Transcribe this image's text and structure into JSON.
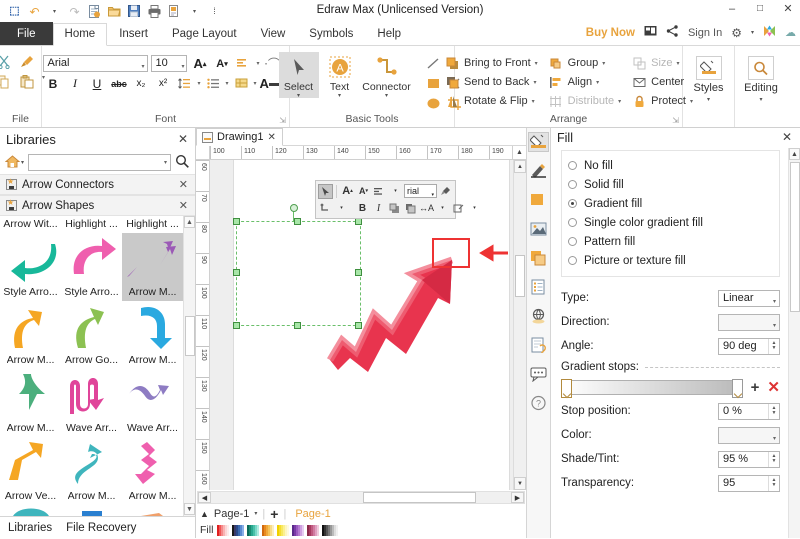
{
  "app": {
    "title": "Edraw Max (Unlicensed Version)",
    "accent_orange": "#e8a33d",
    "selection_green": "#6abf6a",
    "annotation_red": "#ee3333"
  },
  "quick_access": {
    "items": [
      {
        "name": "edraw-logo-icon",
        "glyph": "E"
      },
      {
        "name": "undo-icon",
        "glyph": "↶"
      },
      {
        "name": "undo-dropdown-caret-icon",
        "glyph": "▾"
      },
      {
        "name": "redo-icon",
        "glyph": "↷"
      },
      {
        "name": "new-document-icon",
        "glyph": "὜B"
      },
      {
        "name": "open-folder-icon",
        "glyph": "Ὄ2"
      },
      {
        "name": "save-icon",
        "glyph": "ὋE"
      },
      {
        "name": "print-icon",
        "glyph": "⎙"
      },
      {
        "name": "export-icon",
        "glyph": "὜E"
      },
      {
        "name": "quick-access-caret-icon",
        "glyph": "▾"
      },
      {
        "name": "customize-quick-access-icon",
        "glyph": "⋮"
      }
    ]
  },
  "window_controls": [
    {
      "name": "minimize-button",
      "glyph": "–"
    },
    {
      "name": "maximize-button",
      "glyph": "☐"
    },
    {
      "name": "close-button",
      "glyph": "✕"
    }
  ],
  "ribbon_tabs": [
    {
      "label": "File",
      "active": false,
      "kind": "file"
    },
    {
      "label": "Home",
      "active": true,
      "kind": "tab"
    },
    {
      "label": "Insert",
      "active": false,
      "kind": "tab"
    },
    {
      "label": "Page Layout",
      "active": false,
      "kind": "tab"
    },
    {
      "label": "View",
      "active": false,
      "kind": "tab"
    },
    {
      "label": "Symbols",
      "active": false,
      "kind": "tab"
    },
    {
      "label": "Help",
      "active": false,
      "kind": "tab"
    }
  ],
  "account_bar": {
    "buy_now": "Buy Now",
    "present_icon": "present-icon",
    "share_icon": "share-icon",
    "sign_in": "Sign In",
    "settings_icon": "gear-icon",
    "settings_caret": "▾",
    "theme_icon": "theme-icon",
    "cloud_icon": "cloud-icon"
  },
  "ribbon": {
    "groups": [
      {
        "name": "file",
        "label": "File"
      },
      {
        "name": "font",
        "label": "Font"
      },
      {
        "name": "basic-tools",
        "label": "Basic Tools"
      },
      {
        "name": "arrange",
        "label": "Arrange"
      },
      {
        "name": "styles",
        "label": ""
      },
      {
        "name": "editing",
        "label": ""
      }
    ],
    "clipboard": {
      "cut": "cut-icon",
      "format_painter": "format-painter-icon",
      "copy": "copy-icon",
      "paste": "paste-icon",
      "paste_caret": "▾"
    },
    "font": {
      "family_value": "Arial",
      "size_value": "10",
      "grow_font": "A",
      "shrink_font": "A",
      "text_align_icon": "text-align-icon",
      "curve_text_icon": "curve-text-icon",
      "bold": "B",
      "italic": "I",
      "underline": "U",
      "strikethrough": "abc",
      "subscript": "x₂",
      "superscript": "x²",
      "line_spacing_icon": "line-spacing-icon",
      "bullets_icon": "bullets-icon",
      "highlight_icon": "text-highlight-icon",
      "font_color": "A",
      "dialog_launcher": "⤵"
    },
    "basic_tools": {
      "select": "Select",
      "text": "Text",
      "connector": "Connector",
      "shapes": [
        "line-icon",
        "arc-icon",
        "rectangle-icon",
        "cross-icon",
        "ellipse-icon",
        "crop-icon"
      ]
    },
    "arrange": {
      "items": [
        {
          "label": "Bring to Front",
          "icon": "bring-to-front-icon",
          "caret": true,
          "disabled": false
        },
        {
          "label": "Send to Back",
          "icon": "send-to-back-icon",
          "caret": true,
          "disabled": false
        },
        {
          "label": "Rotate & Flip",
          "icon": "rotate-flip-icon",
          "caret": true,
          "disabled": false
        },
        {
          "label": "Group",
          "icon": "group-icon",
          "caret": true,
          "disabled": false
        },
        {
          "label": "Align",
          "icon": "align-icon",
          "caret": true,
          "disabled": false
        },
        {
          "label": "Distribute",
          "icon": "distribute-icon",
          "caret": true,
          "disabled": true
        },
        {
          "label": "Size",
          "icon": "size-icon",
          "caret": true,
          "disabled": true
        },
        {
          "label": "Center",
          "icon": "center-icon",
          "caret": false,
          "disabled": false
        },
        {
          "label": "Protect",
          "icon": "lock-icon",
          "caret": true,
          "disabled": false
        }
      ],
      "dialog_launcher": "⤵"
    },
    "styles": {
      "label": "Styles",
      "icon": "styles-fill-icon",
      "caret": "▾"
    },
    "editing": {
      "label": "Editing",
      "icon": "search-icon",
      "caret": "▾"
    }
  },
  "libraries_panel": {
    "title": "Libraries",
    "close_icon": "close-icon",
    "home_icon": "home-icon",
    "home_caret": "▾",
    "search_value": "",
    "search_caret": "▾",
    "search_icon": "search-icon",
    "library_groups": [
      {
        "label": "Arrow Connectors",
        "close_icon": "close-icon"
      },
      {
        "label": "Arrow Shapes",
        "close_icon": "close-icon"
      }
    ],
    "shapes": [
      {
        "label": "Arrow Wit...",
        "color": "#18b89a",
        "kind": "curve-left",
        "selected": false
      },
      {
        "label": "Highlight ...",
        "color": "#ef5fae",
        "kind": "curve-right",
        "selected": false
      },
      {
        "label": "Highlight ...",
        "color": "#9b59b6",
        "kind": "zigzag-up",
        "selected": true
      },
      {
        "label": "Style Arro...",
        "color": "#18b89a",
        "kind": "curve-left",
        "selected": false
      },
      {
        "label": "Style Arro...",
        "color": "#ef5fae",
        "kind": "curve-right",
        "selected": false
      },
      {
        "label": "Arrow M...",
        "color": "#9b59b6",
        "kind": "zigzag-up",
        "selected": true
      },
      {
        "label": "Arrow M...",
        "color": "#f5a623",
        "kind": "curve-up",
        "selected": false
      },
      {
        "label": "Arrow Go...",
        "color": "#8cc152",
        "kind": "curve-up-green",
        "selected": false
      },
      {
        "label": "Arrow M...",
        "color": "#2aa9e0",
        "kind": "hook-down",
        "selected": false
      },
      {
        "label": "Arrow M...",
        "color": "#4caf7d",
        "kind": "down-bend",
        "selected": false
      },
      {
        "label": "Wave Arr...",
        "color": "#e0459a",
        "kind": "wave",
        "selected": false
      },
      {
        "label": "Wave Arr...",
        "color": "#8e7cc3",
        "kind": "wave-thin",
        "selected": false
      },
      {
        "label": "Arrow Ve...",
        "color": "#f5a623",
        "kind": "thick-up",
        "selected": false
      },
      {
        "label": "Arrow M...",
        "color": "#3fb5bd",
        "kind": "s-curve",
        "selected": false
      },
      {
        "label": "Arrow M...",
        "color": "#ef5fae",
        "kind": "zigzag-down",
        "selected": false
      }
    ],
    "scroll_up_icon": "scroll-up-icon",
    "scroll_down_icon": "scroll-down-icon",
    "bottom_tabs": [
      {
        "label": "Libraries",
        "active": true
      },
      {
        "label": "File Recovery",
        "active": false
      }
    ]
  },
  "document": {
    "tabs": [
      {
        "label": "Drawing1",
        "icon": "document-icon",
        "close_icon": "close-icon"
      }
    ],
    "ruler_h_ticks": [
      "100",
      "110",
      "120",
      "130",
      "140",
      "150",
      "160",
      "170",
      "180",
      "190"
    ],
    "ruler_v_ticks": [
      "60",
      "70",
      "80",
      "90",
      "100",
      "110",
      "120",
      "130",
      "140",
      "150",
      "160"
    ],
    "ruler_collapse_icon": "collapse-ruler-icon"
  },
  "mini_toolbar": {
    "row1": [
      {
        "name": "pointer-tool-icon",
        "glyph": "➤",
        "selected": true
      },
      {
        "name": "grow-font-icon",
        "glyph": "A"
      },
      {
        "name": "shrink-font-icon",
        "glyph": "A"
      },
      {
        "name": "align-icon",
        "glyph": "≡",
        "caret": true
      },
      {
        "name": "font-family-field",
        "value": "rial",
        "caret": "▾"
      },
      {
        "name": "format-painter-icon",
        "glyph": "὘C"
      }
    ],
    "row2": [
      {
        "name": "connector-tool-icon",
        "glyph": "⤴",
        "caret": true
      },
      {
        "name": "bold-icon",
        "glyph": "B"
      },
      {
        "name": "italic-icon",
        "glyph": "I"
      },
      {
        "name": "bring-to-front-icon",
        "glyph": "❐"
      },
      {
        "name": "send-to-back-icon",
        "glyph": "❑"
      },
      {
        "name": "spacing-icon",
        "glyph": "↕",
        "caret": true
      },
      {
        "name": "line-style-icon",
        "glyph": "✎",
        "caret": true
      }
    ]
  },
  "canvas": {
    "shape_name": "red-zigzag-growth-arrow",
    "shape_color": "#e8344e",
    "selection_handles": 8,
    "rotation_handle": "rotation-handle",
    "annotation": {
      "rect_name": "annotation-highlight-rectangle",
      "arrow_name": "annotation-pointer-arrow",
      "color": "#ee3333"
    }
  },
  "status_bar": {
    "collapse_icon": "collapse-icon",
    "page_selector": "Page-1",
    "page_selector_caret": "▾",
    "add_page_icon": "+",
    "page_tab": "Page-1",
    "fill_label": "Fill",
    "h_scroll_left_icon": "◀",
    "h_scroll_right_icon": "▶"
  },
  "right_icon_strip": [
    {
      "name": "fill-icon",
      "glyph": "὘C",
      "selected": true
    },
    {
      "name": "line-icon",
      "glyph": "✒",
      "selected": false
    },
    {
      "name": "shadow-icon",
      "glyph": "■",
      "selected": false
    },
    {
      "name": "picture-icon",
      "glyph": "ὛC",
      "selected": false
    },
    {
      "name": "layer-icon",
      "glyph": "❐",
      "selected": false
    },
    {
      "name": "properties-icon",
      "glyph": "ὌB",
      "selected": false
    },
    {
      "name": "hyperlink-icon",
      "glyph": "ἱ0",
      "selected": false
    },
    {
      "name": "attachment-icon",
      "glyph": "ὌE",
      "selected": false
    },
    {
      "name": "comment-icon",
      "glyph": "ὊC",
      "selected": false
    },
    {
      "name": "help-icon",
      "glyph": "?",
      "selected": false
    }
  ],
  "fill_panel": {
    "title": "Fill",
    "close_icon": "close-icon",
    "fill_options": [
      {
        "label": "No fill",
        "selected": false
      },
      {
        "label": "Solid fill",
        "selected": false
      },
      {
        "label": "Gradient fill",
        "selected": true
      },
      {
        "label": "Single color gradient fill",
        "selected": false
      },
      {
        "label": "Pattern fill",
        "selected": false
      },
      {
        "label": "Picture or texture fill",
        "selected": false
      }
    ],
    "fields": {
      "type_label": "Type:",
      "type_value": "Linear",
      "direction_label": "Direction:",
      "direction_value": "",
      "angle_label": "Angle:",
      "angle_value": "90 deg",
      "gradient_stops_label": "Gradient stops:",
      "add_stop_icon": "+",
      "remove_stop_icon": "✕",
      "stop_position_label": "Stop position:",
      "stop_position_value": "0 %",
      "color_label": "Color:",
      "color_value": "",
      "shade_tint_label": "Shade/Tint:",
      "shade_tint_value": "95 %",
      "transparency_label": "Transparency:",
      "transparency_value": "95"
    },
    "scroll_up_icon": "scroll-up-icon",
    "scroll_down_icon": "scroll-down-icon"
  }
}
